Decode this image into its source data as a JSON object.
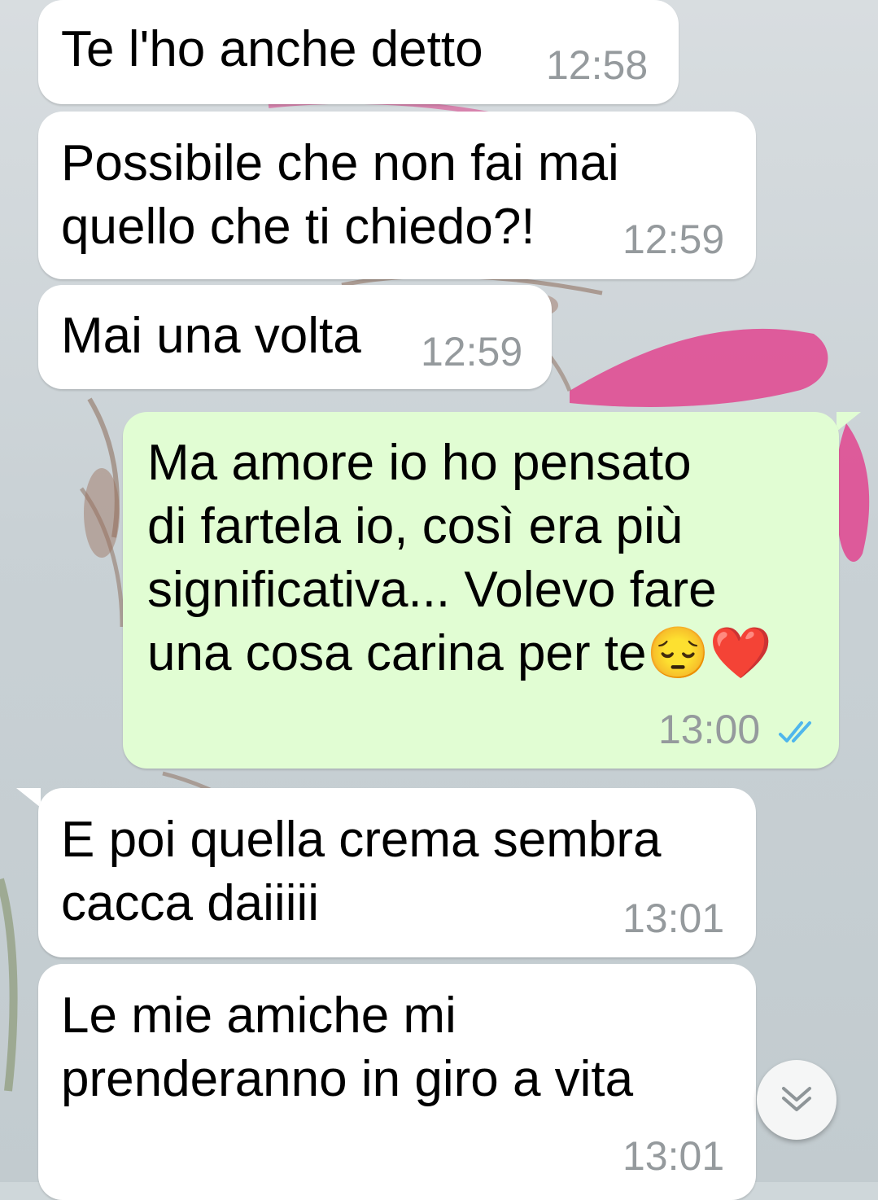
{
  "messages": [
    {
      "direction": "incoming",
      "text": "Te l'ho anche detto",
      "time": "12:58"
    },
    {
      "direction": "incoming",
      "text": "Possibile che non fai mai\nquello che ti chiedo?!",
      "time": "12:59"
    },
    {
      "direction": "incoming",
      "text": "Mai una volta",
      "time": "12:59"
    },
    {
      "direction": "outgoing",
      "text": "Ma amore io ho pensato\ndi fartela io, così era più\nsignificativa... Volevo fare\nuna cosa carina per te😔❤️",
      "time": "13:00",
      "status": "read"
    },
    {
      "direction": "incoming",
      "text": "E poi quella crema sembra\ncacca daiiiii",
      "time": "13:01"
    },
    {
      "direction": "incoming",
      "text": "Le mie amiche mi\nprenderanno in giro a vita",
      "time": "13:01"
    }
  ],
  "scroll_button": {
    "icon": "double-chevron-down-icon"
  },
  "colors": {
    "incoming_bubble": "#ffffff",
    "outgoing_bubble": "#e1fdd3",
    "timestamp": "#959a9d",
    "read_ticks": "#4fb6ec",
    "wallpaper_flower": "#e0458f"
  }
}
